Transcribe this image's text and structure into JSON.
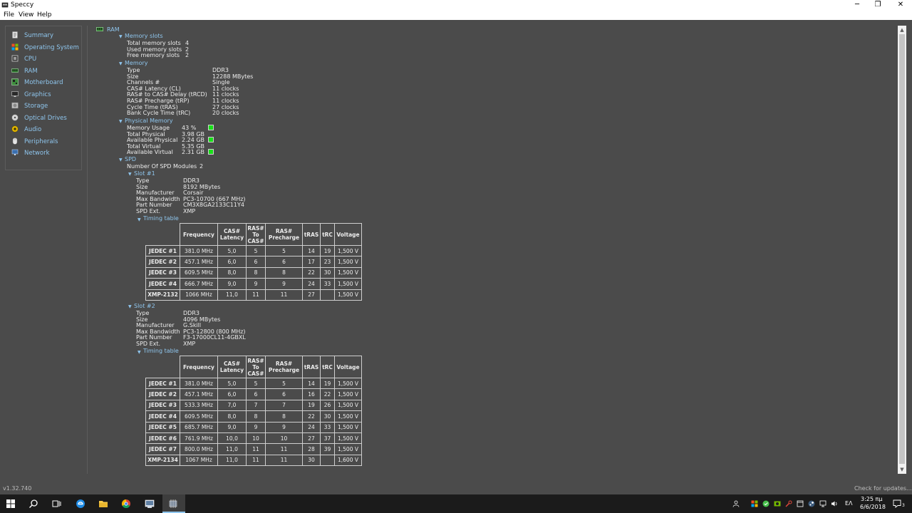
{
  "window": {
    "title": "Speccy",
    "minimize": "─",
    "maximize": "❐",
    "close": "✕"
  },
  "menu": [
    "File",
    "View",
    "Help"
  ],
  "sidebar": {
    "items": [
      {
        "label": "Summary",
        "icon": "summary-icon"
      },
      {
        "label": "Operating System",
        "icon": "windows-logo-icon"
      },
      {
        "label": "CPU",
        "icon": "cpu-icon"
      },
      {
        "label": "RAM",
        "icon": "ram-icon"
      },
      {
        "label": "Motherboard",
        "icon": "motherboard-icon"
      },
      {
        "label": "Graphics",
        "icon": "graphics-icon"
      },
      {
        "label": "Storage",
        "icon": "storage-icon"
      },
      {
        "label": "Optical Drives",
        "icon": "optical-drive-icon"
      },
      {
        "label": "Audio",
        "icon": "audio-icon"
      },
      {
        "label": "Peripherals",
        "icon": "peripherals-icon"
      },
      {
        "label": "Network",
        "icon": "network-icon"
      }
    ]
  },
  "ram": {
    "title": "RAM",
    "memory_slots": {
      "heading": "Memory slots",
      "rows": [
        {
          "label": "Total memory slots",
          "value": "4"
        },
        {
          "label": "Used memory slots",
          "value": "2"
        },
        {
          "label": "Free memory slots",
          "value": "2"
        }
      ]
    },
    "memory": {
      "heading": "Memory",
      "rows": [
        {
          "label": "Type",
          "value": "DDR3"
        },
        {
          "label": "Size",
          "value": "12288 MBytes"
        },
        {
          "label": "Channels #",
          "value": "Single"
        },
        {
          "label": "CAS# Latency (CL)",
          "value": "11 clocks"
        },
        {
          "label": "RAS# to CAS# Delay (tRCD)",
          "value": "11 clocks"
        },
        {
          "label": "RAS# Precharge (tRP)",
          "value": "11 clocks"
        },
        {
          "label": "Cycle Time (tRAS)",
          "value": "27 clocks"
        },
        {
          "label": "Bank Cycle Time (tRC)",
          "value": "20 clocks"
        }
      ]
    },
    "physical_memory": {
      "heading": "Physical Memory",
      "rows": [
        {
          "label": "Memory Usage",
          "value": "43 %"
        },
        {
          "label": "Total Physical",
          "value": "3.98 GB"
        },
        {
          "label": "Available Physical",
          "value": "2.24 GB"
        },
        {
          "label": "Total Virtual",
          "value": "5.35 GB"
        },
        {
          "label": "Available Virtual",
          "value": "2.31 GB"
        }
      ]
    },
    "spd": {
      "heading": "SPD",
      "modules_label": "Number Of SPD Modules",
      "modules_value": "2",
      "slots": [
        {
          "heading": "Slot #1",
          "rows": [
            {
              "label": "Type",
              "value": "DDR3"
            },
            {
              "label": "Size",
              "value": "8192 MBytes"
            },
            {
              "label": "Manufacturer",
              "value": "Corsair"
            },
            {
              "label": "Max Bandwidth",
              "value": "PC3-10700 (667 MHz)"
            },
            {
              "label": "Part Number",
              "value": "CM3X8GA2133C11Y4"
            },
            {
              "label": "SPD Ext.",
              "value": "XMP"
            }
          ],
          "timing_heading": "Timing table",
          "timing_rows": [
            [
              "JEDEC #1",
              "381.0 MHz",
              "5,0",
              "5",
              "5",
              "14",
              "19",
              "1,500 V"
            ],
            [
              "JEDEC #2",
              "457.1 MHz",
              "6,0",
              "6",
              "6",
              "17",
              "23",
              "1,500 V"
            ],
            [
              "JEDEC #3",
              "609.5 MHz",
              "8,0",
              "8",
              "8",
              "22",
              "30",
              "1,500 V"
            ],
            [
              "JEDEC #4",
              "666.7 MHz",
              "9,0",
              "9",
              "9",
              "24",
              "33",
              "1,500 V"
            ],
            [
              "XMP-2132",
              "1066 MHz",
              "11,0",
              "11",
              "11",
              "27",
              "",
              "1,500 V"
            ]
          ]
        },
        {
          "heading": "Slot #2",
          "rows": [
            {
              "label": "Type",
              "value": "DDR3"
            },
            {
              "label": "Size",
              "value": "4096 MBytes"
            },
            {
              "label": "Manufacturer",
              "value": "G.Skill"
            },
            {
              "label": "Max Bandwidth",
              "value": "PC3-12800 (800 MHz)"
            },
            {
              "label": "Part Number",
              "value": "F3-17000CL11-4GBXL"
            },
            {
              "label": "SPD Ext.",
              "value": "XMP"
            }
          ],
          "timing_heading": "Timing table",
          "timing_rows": [
            [
              "JEDEC #1",
              "381.0 MHz",
              "5,0",
              "5",
              "5",
              "14",
              "19",
              "1,500 V"
            ],
            [
              "JEDEC #2",
              "457.1 MHz",
              "6,0",
              "6",
              "6",
              "16",
              "22",
              "1,500 V"
            ],
            [
              "JEDEC #3",
              "533.3 MHz",
              "7,0",
              "7",
              "7",
              "19",
              "26",
              "1,500 V"
            ],
            [
              "JEDEC #4",
              "609.5 MHz",
              "8,0",
              "8",
              "8",
              "22",
              "30",
              "1,500 V"
            ],
            [
              "JEDEC #5",
              "685.7 MHz",
              "9,0",
              "9",
              "9",
              "24",
              "33",
              "1,500 V"
            ],
            [
              "JEDEC #6",
              "761.9 MHz",
              "10,0",
              "10",
              "10",
              "27",
              "37",
              "1,500 V"
            ],
            [
              "JEDEC #7",
              "800.0 MHz",
              "11,0",
              "11",
              "11",
              "28",
              "39",
              "1,500 V"
            ],
            [
              "XMP-2134",
              "1067 MHz",
              "11,0",
              "11",
              "11",
              "30",
              "",
              "1,600 V"
            ]
          ]
        }
      ]
    },
    "timing_columns": [
      "",
      "Frequency",
      "CAS# Latency",
      "RAS# To CAS#",
      "RAS# Precharge",
      "tRAS",
      "tRC",
      "Voltage"
    ]
  },
  "status": {
    "version": "v1.32.740",
    "update_link": "Check for updates..."
  },
  "taskbar": {
    "apps": [
      "start-icon",
      "search-icon",
      "task-view-icon",
      "edge-icon",
      "file-explorer-icon",
      "chrome-icon",
      "app-icon",
      "speccy-icon"
    ],
    "language": "ΕΛ",
    "time": "3:25 πμ",
    "date": "6/6/2018",
    "notifications": "3"
  },
  "colors": {
    "background": "#4b4b4b",
    "link": "#8fc6ee",
    "indicator": "#19e019",
    "taskbar": "#1b1b1b"
  }
}
